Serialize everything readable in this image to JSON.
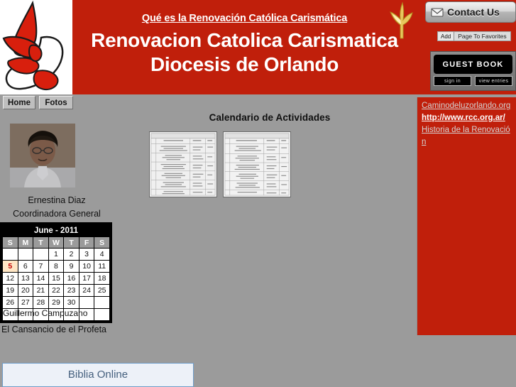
{
  "header": {
    "tagline": "Qué es la Renovación Católica Carismática ",
    "title_line1": "Renovacion Catolica Carismatica",
    "title_line2": "Diocesis de Orlando",
    "logo_icon": "dove-flame-logo",
    "gold_dove_icon": "gold-dove-icon",
    "contact_us": {
      "label": "Contact Us",
      "icon": "envelope-icon"
    },
    "favorites": {
      "add_label": "Add",
      "text_label": "Page To Favorites"
    },
    "guestbook": {
      "title": "GUEST BOOK",
      "sign_in_label": "sign in",
      "view_entries_label": "view entries"
    }
  },
  "nav": {
    "tabs": [
      {
        "label": "Home",
        "name": "tab-home"
      },
      {
        "label": "Fotos",
        "name": "tab-fotos"
      }
    ]
  },
  "sidebar": {
    "coordinator": {
      "photo_alt": "coordinator-portrait",
      "name": "Ernestina Diaz",
      "role": "Coordinadora General"
    },
    "calendar": {
      "title": "June - 2011",
      "weekday_headers": [
        "S",
        "M",
        "T",
        "W",
        "T",
        "F",
        "S"
      ],
      "weeks": [
        [
          "",
          "",
          "",
          "1",
          "2",
          "3",
          "4"
        ],
        [
          "5",
          "6",
          "7",
          "8",
          "9",
          "10",
          "11"
        ],
        [
          "12",
          "13",
          "14",
          "15",
          "16",
          "17",
          "18"
        ],
        [
          "19",
          "20",
          "21",
          "22",
          "23",
          "24",
          "25"
        ],
        [
          "26",
          "27",
          "28",
          "29",
          "30",
          "",
          ""
        ]
      ],
      "today": "5",
      "event_text": "Guillermo Campuzano"
    },
    "prophet_note": "El Cansancio de el Profeta",
    "biblia_online": {
      "label": "Biblia Online"
    }
  },
  "main": {
    "title": "Calendario de Actividades",
    "thumbnails": [
      {
        "name": "calendar-document-thumbnail-1",
        "alt": "calendario-pagina-1"
      },
      {
        "name": "calendar-document-thumbnail-2",
        "alt": "calendario-pagina-2"
      }
    ]
  },
  "right_panel": {
    "links": [
      {
        "label": "Caminodeluzorlando.org",
        "bold": false
      },
      {
        "label": "http://www.rcc.org.ar/",
        "bold": true
      },
      {
        "label": "Historia de la Renovación",
        "bold": false
      }
    ]
  },
  "colors": {
    "brand_red": "#c01f0b",
    "page_gray": "#9b9b9b",
    "link_gray": "#d4d4d4",
    "calendar_today_bg": "#ffe6c4",
    "biblia_border": "#6f9cc8"
  }
}
